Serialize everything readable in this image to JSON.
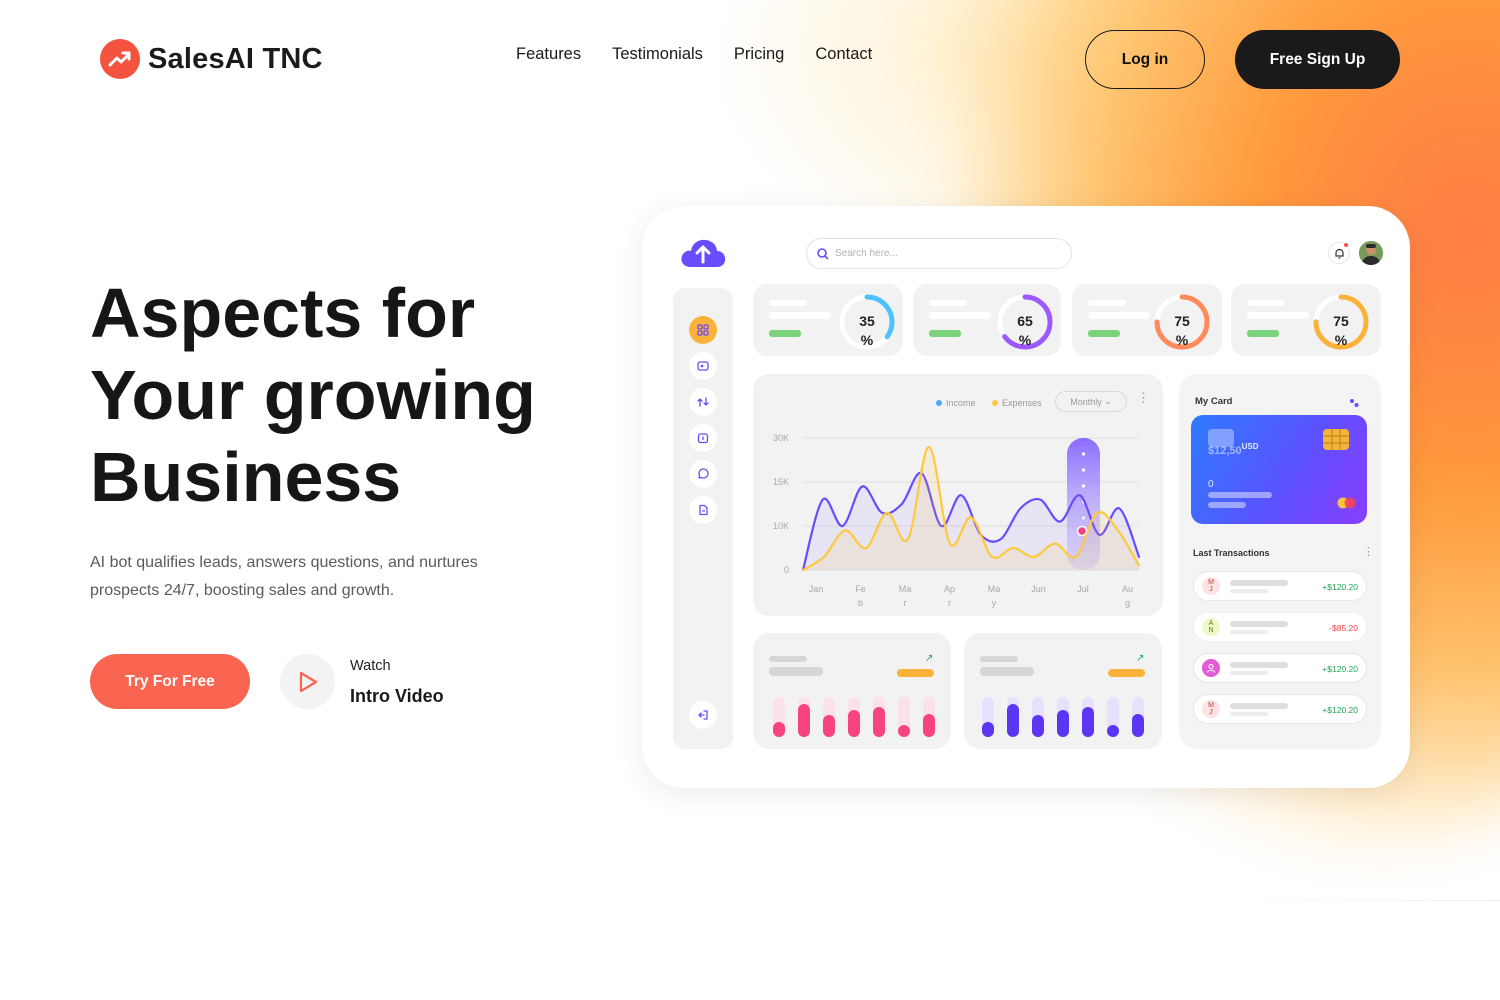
{
  "brand": {
    "name": "SalesAI TNC"
  },
  "nav": {
    "items": [
      "Features",
      "Testimonials",
      "Pricing",
      "Contact"
    ]
  },
  "header": {
    "login_label": "Log in",
    "signup_label": "Free Sign Up"
  },
  "hero": {
    "title_lines": [
      "Aspects for",
      "Your growing",
      "Business"
    ],
    "description": "AI bot qualifies leads, answers questions, and nurtures prospects 24/7, boosting sales and growth.",
    "cta_label": "Try For Free",
    "video_small": "Watch",
    "video_big": "Intro Video"
  },
  "dashboard": {
    "search_placeholder": "Search here...",
    "stats": [
      {
        "value": "35",
        "unit": "%",
        "progress": 0.35,
        "color": "#4cc3ff"
      },
      {
        "value": "65",
        "unit": "%",
        "progress": 0.65,
        "color": "#9b59ff"
      },
      {
        "value": "75",
        "unit": "%",
        "progress": 0.75,
        "color": "#ff8a5c"
      },
      {
        "value": "75",
        "unit": "%",
        "progress": 0.75,
        "color": "#fbb23a"
      }
    ],
    "legend": {
      "income": "Income",
      "expenses": "Expenses"
    },
    "period": "Monthly",
    "card": {
      "title": "My Card",
      "balance": "$12,50",
      "currency": "USD",
      "number": "0"
    },
    "transactions_title": "Last Transactions",
    "transactions": [
      {
        "initials": "M\nJ",
        "amount": "+$120.20",
        "positive": true
      },
      {
        "initials": "A\nN",
        "amount": "-$85.20",
        "positive": false
      },
      {
        "initials": "",
        "amount": "+$120.20",
        "positive": true
      },
      {
        "initials": "M\nJ",
        "amount": "+$120.20",
        "positive": true
      }
    ]
  },
  "chart_data": {
    "type": "line",
    "title": "",
    "x": [
      "Jan",
      "Feb",
      "Mar",
      "Apr",
      "May",
      "Jun",
      "Jul",
      "Aug"
    ],
    "y_ticks": [
      "0",
      "10K",
      "15K",
      "30K"
    ],
    "series": [
      {
        "name": "Income",
        "color": "#6a4cff",
        "values": [
          0,
          16,
          10,
          19,
          13,
          15,
          22,
          10,
          17,
          8,
          7,
          14,
          16,
          11,
          17,
          8,
          14,
          3
        ]
      },
      {
        "name": "Expenses",
        "color": "#fdc93d",
        "values": [
          0,
          3,
          9,
          5,
          13,
          7,
          28,
          6,
          12,
          3,
          5,
          3,
          6,
          3,
          13,
          9,
          1
        ]
      }
    ],
    "highlight_month": "Jul"
  }
}
